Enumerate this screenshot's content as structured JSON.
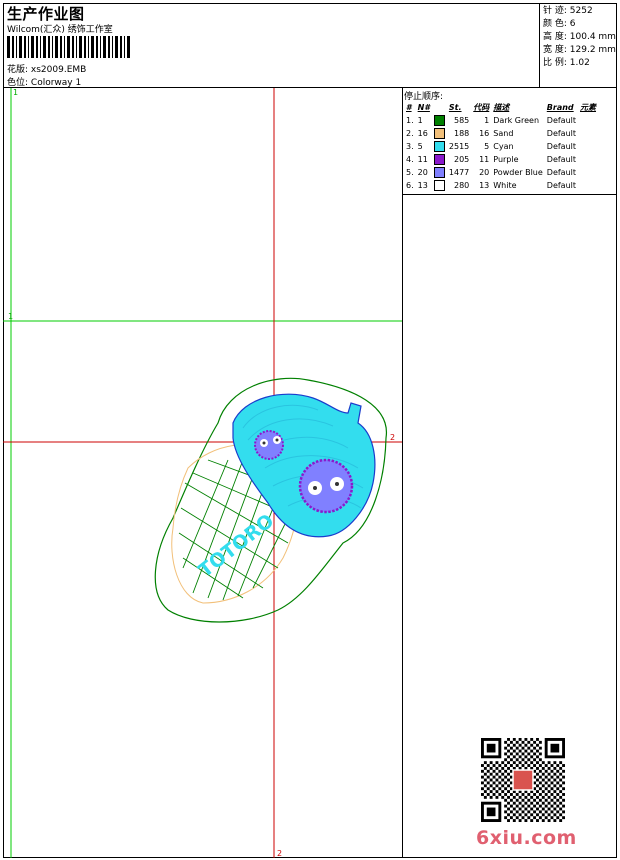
{
  "header": {
    "title": "生产作业图",
    "studio": "Wilcom(汇众) 绣饰工作室",
    "design_label": "花版:",
    "design_value": "xs2009.EMB",
    "colorway_label": "色位:",
    "colorway_value": "Colorway 1"
  },
  "stats": [
    {
      "label": "针 迹:",
      "value": "5252"
    },
    {
      "label": "颜 色:",
      "value": "6"
    },
    {
      "label": "高 度:",
      "value": "100.4 mm"
    },
    {
      "label": "宽 度:",
      "value": "129.2 mm"
    },
    {
      "label": "比 例:",
      "value": "1.02"
    }
  ],
  "stop_sequence": {
    "title": "停止顺序:",
    "columns": [
      "#",
      "N#",
      "St.",
      "代码",
      "描述",
      "Brand",
      "元素"
    ],
    "rows": [
      {
        "idx": "1.",
        "n": "1",
        "color": "#008000",
        "st": "585",
        "code": "1",
        "desc": "Dark Green",
        "brand": "Default"
      },
      {
        "idx": "2.",
        "n": "16",
        "color": "#f2c07a",
        "st": "188",
        "code": "16",
        "desc": "Sand",
        "brand": "Default"
      },
      {
        "idx": "3.",
        "n": "5",
        "color": "#33ddee",
        "st": "2515",
        "code": "5",
        "desc": "Cyan",
        "brand": "Default"
      },
      {
        "idx": "4.",
        "n": "11",
        "color": "#8a1acc",
        "st": "205",
        "code": "11",
        "desc": "Purple",
        "brand": "Default"
      },
      {
        "idx": "5.",
        "n": "20",
        "color": "#8080ff",
        "st": "1477",
        "code": "20",
        "desc": "Powder Blue",
        "brand": "Default"
      },
      {
        "idx": "6.",
        "n": "13",
        "color": "#ffffff",
        "st": "280",
        "code": "13",
        "desc": "White",
        "brand": "Default"
      }
    ]
  },
  "canvas": {
    "axis_label_1": "1",
    "axis_label_2": "2",
    "design_text": "TOTORO",
    "guide_colors": {
      "green": "#00cc00",
      "red": "#cc0000"
    }
  },
  "watermark": "6xiu.com"
}
